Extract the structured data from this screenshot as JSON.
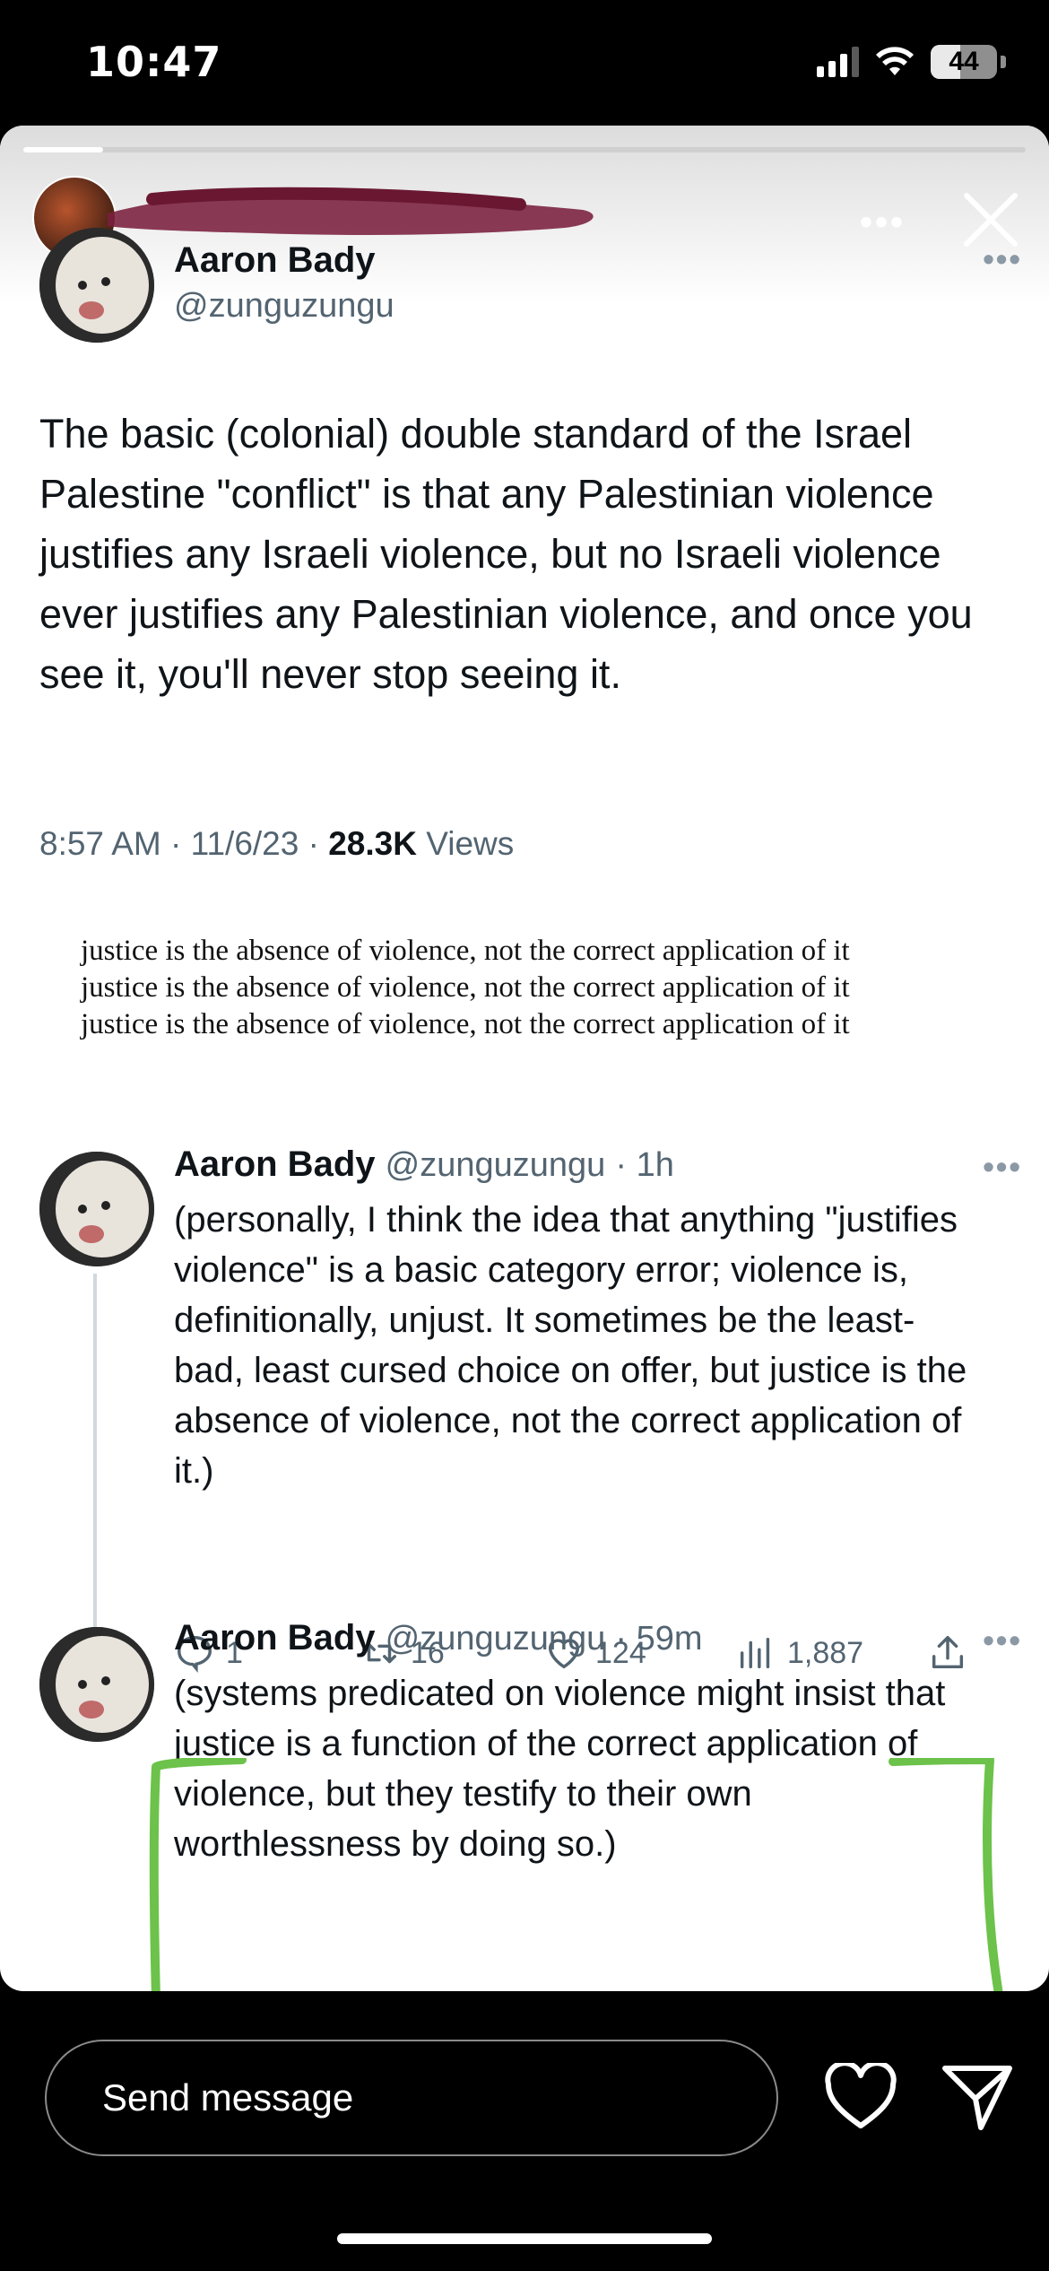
{
  "status_bar": {
    "time": "10:47",
    "battery": "44"
  },
  "story": {
    "progress": 0.08,
    "more_label": "•••"
  },
  "tweet": {
    "author_name": "Aaron Bady",
    "author_handle": "@zunguzungu",
    "text": "The basic (colonial) double standard of the Israel Palestine \"conflict\" is that any Palestinian violence justifies any Israeli violence, but no Israeli violence ever justifies any Palestinian violence, and once you see it, you'll never stop seeing it.",
    "time": "8:57 AM · 11/6/23 · ",
    "views_count": "28.3K",
    "views_label": " Views"
  },
  "quote_lines": [
    "justice is the absence of violence, not the correct application of it",
    "justice is the absence of violence, not the correct application of it",
    "justice is the absence of violence, not the correct application of it"
  ],
  "replies": [
    {
      "author_name": "Aaron Bady",
      "author_handle": "@zunguzungu",
      "age": "· 1h",
      "text": "(personally, I think the idea that anything \"justifies violence\" is a basic category error; violence is, definitionally, unjust. It sometimes be the least-bad, least cursed choice on offer, but justice is the absence of violence, not the correct application of it.)",
      "replies_count": "1",
      "retweets_count": "16",
      "likes_count": "124",
      "views_count": "1,887"
    },
    {
      "author_name": "Aaron Bady",
      "author_handle": "@zunguzungu",
      "age": "· 59m",
      "text": "(systems predicated on violence might insist that justice is a function of the correct application of violence, but they testify to their own worthlessness by doing so.)"
    }
  ],
  "bottom_bar": {
    "send_placeholder": "Send message"
  },
  "colors": {
    "annotation_green": "#6cc24a",
    "scribble": "#7a1f3d"
  }
}
